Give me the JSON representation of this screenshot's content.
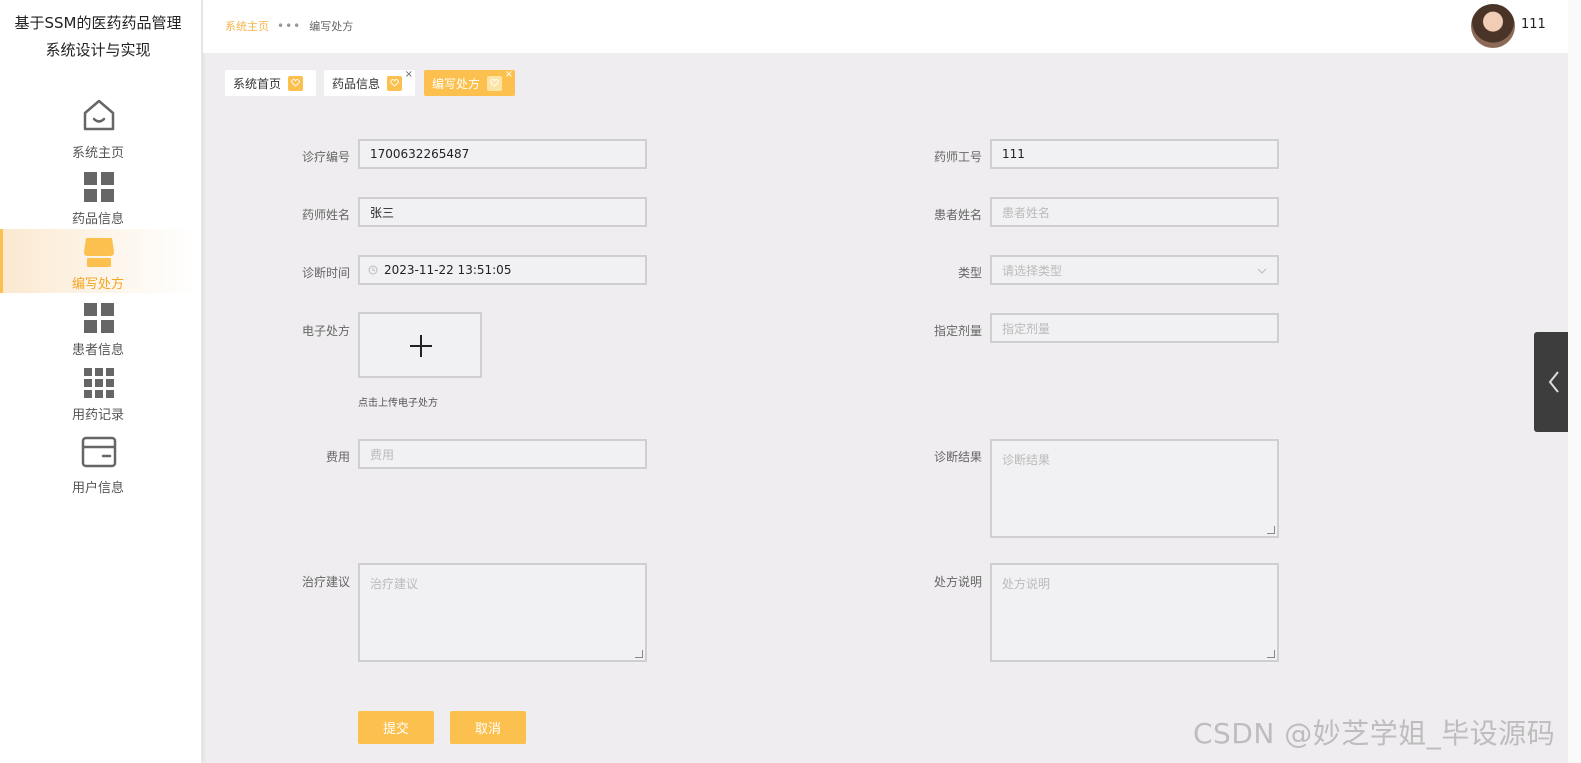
{
  "app": {
    "title_line1": "基于SSM的医药药品管理",
    "title_line2": "系统设计与实现"
  },
  "sidebar": {
    "items": [
      {
        "label": "系统主页",
        "icon": "home-icon"
      },
      {
        "label": "药品信息",
        "icon": "grid-icon"
      },
      {
        "label": "编写处方",
        "icon": "shop-icon",
        "active": true
      },
      {
        "label": "患者信息",
        "icon": "grid-icon"
      },
      {
        "label": "用药记录",
        "icon": "apps-icon"
      },
      {
        "label": "用户信息",
        "icon": "card-icon"
      }
    ]
  },
  "header": {
    "breadcrumb_home": "系统主页",
    "breadcrumb_sep": "•••",
    "breadcrumb_current": "编写处方",
    "username": "111"
  },
  "tabs": [
    {
      "label": "系统首页",
      "closable": false
    },
    {
      "label": "药品信息",
      "closable": true,
      "close": "×"
    },
    {
      "label": "编写处方",
      "closable": true,
      "active": true,
      "close": "×"
    }
  ],
  "form": {
    "zhenliao_bianhao": {
      "label": "诊疗编号",
      "value": "1700632265487"
    },
    "yaoshi_gonghao": {
      "label": "药师工号",
      "value": "111"
    },
    "yaoshi_xingming": {
      "label": "药师姓名",
      "value": "张三"
    },
    "huanzhe_xingming": {
      "label": "患者姓名",
      "placeholder": "患者姓名"
    },
    "zhenduan_shijian": {
      "label": "诊断时间",
      "value": "2023-11-22 13:51:05"
    },
    "leixing": {
      "label": "类型",
      "placeholder": "请选择类型"
    },
    "dianzi_chufang": {
      "label": "电子处方",
      "hint": "点击上传电子处方"
    },
    "zhiding_jiliang": {
      "label": "指定剂量",
      "placeholder": "指定剂量"
    },
    "feiyong": {
      "label": "费用",
      "placeholder": "费用"
    },
    "zhenduan_jieguo": {
      "label": "诊断结果",
      "placeholder": "诊断结果"
    },
    "zhiliao_jianyi": {
      "label": "治疗建议",
      "placeholder": "治疗建议"
    },
    "chufang_shuoming": {
      "label": "处方说明",
      "placeholder": "处方说明"
    },
    "submit_label": "提交",
    "cancel_label": "取消"
  },
  "watermark": "CSDN @妙芝学姐_毕设源码",
  "colors": {
    "accent": "#fcc04e",
    "background": "#efedef",
    "sidebar_active_text": "#f5a623"
  }
}
